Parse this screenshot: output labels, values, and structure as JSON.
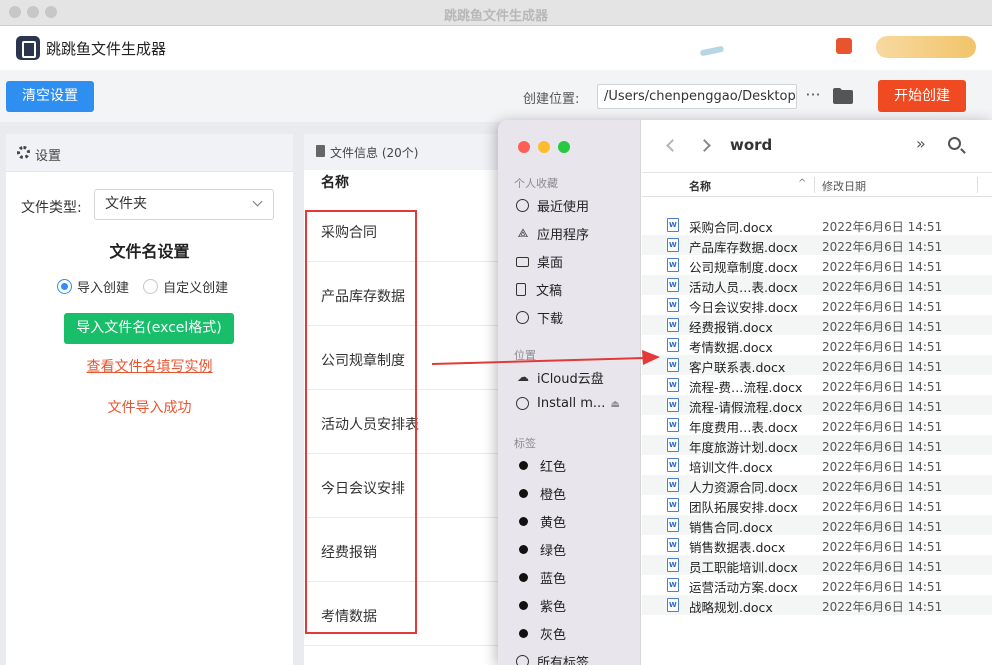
{
  "window": {
    "title": "跳跳鱼文件生成器"
  },
  "app": {
    "name": "跳跳鱼文件生成器"
  },
  "toolbar": {
    "clear_label": "清空设置",
    "location_label": "创建位置:",
    "location_value": "/Users/chenpenggao/Desktop",
    "more_label": "···",
    "start_label": "开始创建"
  },
  "settings": {
    "title": "设置",
    "type_label": "文件类型:",
    "type_value": "文件夹",
    "filename_heading": "文件名设置",
    "radio_import": "导入创建",
    "radio_custom": "自定义创建",
    "import_button": "导入文件名(excel格式)",
    "example_link": "查看文件名填写实例",
    "import_status": "文件导入成功"
  },
  "fileinfo": {
    "title": "文件信息 (20个)",
    "column_name": "名称",
    "rows": [
      "采购合同",
      "产品库存数据",
      "公司规章制度",
      "活动人员安排表",
      "今日会议安排",
      "经费报销",
      "考情数据"
    ]
  },
  "finder": {
    "folder_title": "word",
    "more": "»",
    "sidebar": {
      "favorites_header": "个人收藏",
      "favorites": [
        {
          "icon": "clock-icon",
          "label": "最近使用"
        },
        {
          "icon": "apps-icon",
          "label": "应用程序"
        },
        {
          "icon": "desktop-icon",
          "label": "桌面"
        },
        {
          "icon": "document-icon",
          "label": "文稿"
        },
        {
          "icon": "download-icon",
          "label": "下载"
        }
      ],
      "locations_header": "位置",
      "locations": [
        {
          "icon": "cloud-icon",
          "label": "iCloud云盘"
        },
        {
          "icon": "disk-icon",
          "label": "Install m..."
        }
      ],
      "tags_header": "标签",
      "tags": [
        "红色",
        "橙色",
        "黄色",
        "绿色",
        "蓝色",
        "紫色",
        "灰色"
      ],
      "all_tags": "所有标签..."
    },
    "columns": {
      "name": "名称",
      "date": "修改日期"
    },
    "files": [
      {
        "name": "采购合同.docx",
        "date": "2022年6月6日 14:51"
      },
      {
        "name": "产品库存数据.docx",
        "date": "2022年6月6日 14:51"
      },
      {
        "name": "公司规章制度.docx",
        "date": "2022年6月6日 14:51"
      },
      {
        "name": "活动人员…表.docx",
        "date": "2022年6月6日 14:51"
      },
      {
        "name": "今日会议安排.docx",
        "date": "2022年6月6日 14:51"
      },
      {
        "name": "经费报销.docx",
        "date": "2022年6月6日 14:51"
      },
      {
        "name": "考情数据.docx",
        "date": "2022年6月6日 14:51"
      },
      {
        "name": "客户联系表.docx",
        "date": "2022年6月6日 14:51"
      },
      {
        "name": "流程-费…流程.docx",
        "date": "2022年6月6日 14:51"
      },
      {
        "name": "流程-请假流程.docx",
        "date": "2022年6月6日 14:51"
      },
      {
        "name": "年度费用…表.docx",
        "date": "2022年6月6日 14:51"
      },
      {
        "name": "年度旅游计划.docx",
        "date": "2022年6月6日 14:51"
      },
      {
        "name": "培训文件.docx",
        "date": "2022年6月6日 14:51"
      },
      {
        "name": "人力资源合同.docx",
        "date": "2022年6月6日 14:51"
      },
      {
        "name": "团队拓展安排.docx",
        "date": "2022年6月6日 14:51"
      },
      {
        "name": "销售合同.docx",
        "date": "2022年6月6日 14:51"
      },
      {
        "name": "销售数据表.docx",
        "date": "2022年6月6日 14:51"
      },
      {
        "name": "员工职能培训.docx",
        "date": "2022年6月6日 14:51"
      },
      {
        "name": "运营活动方案.docx",
        "date": "2022年6月6日 14:51"
      },
      {
        "name": "战略规划.docx",
        "date": "2022年6月6日 14:51"
      }
    ]
  },
  "colors": {
    "primary_blue": "#2f8ff0",
    "start_red": "#f04a22",
    "import_green": "#19be6b",
    "link_orange": "#e8542e",
    "annotation_red": "#e23a3a"
  }
}
